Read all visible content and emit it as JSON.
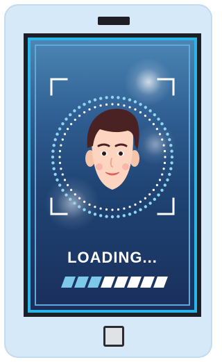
{
  "screen": {
    "loading_label": "LOADING...",
    "progress_fraction": 0.375,
    "progress_segments": 8
  },
  "icons": {
    "face": "face-portrait-icon",
    "scan_frame": "scan-corners-icon",
    "scan_ring": "dotted-scan-ring-icon"
  },
  "colors": {
    "accent": "#2ab6e8",
    "progress_filled": "#7cc9ea",
    "progress_empty": "#ffffff",
    "ring_dots": "#8fd6f2"
  }
}
